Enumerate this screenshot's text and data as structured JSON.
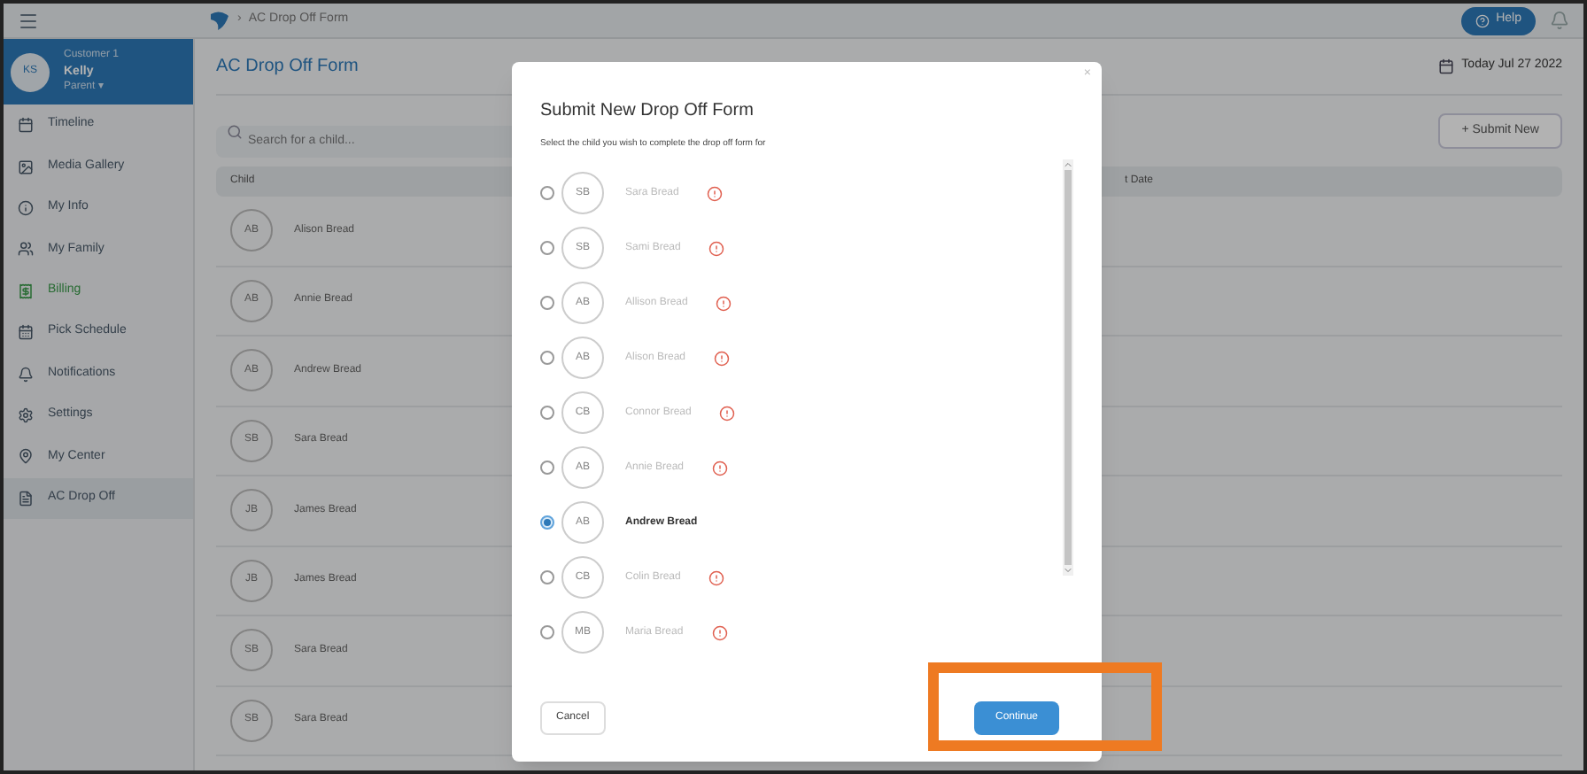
{
  "topbar": {
    "breadcrumb_separator": "›",
    "page": "AC Drop Off Form",
    "help": "Help"
  },
  "user": {
    "initials": "KS",
    "label": "Customer 1",
    "name": "Kelly",
    "role": "Parent ▾"
  },
  "sidebar": {
    "items": [
      {
        "label": "Timeline",
        "selected": false,
        "kind": "calendar"
      },
      {
        "label": "Media Gallery",
        "selected": false,
        "kind": "image"
      },
      {
        "label": "My Info",
        "selected": false,
        "kind": "info"
      },
      {
        "label": "My Family",
        "selected": false,
        "kind": "family"
      },
      {
        "label": "Billing",
        "selected": false,
        "kind": "billing"
      },
      {
        "label": "Pick Schedule",
        "selected": false,
        "kind": "schedule"
      },
      {
        "label": "Notifications",
        "selected": false,
        "kind": "bell"
      },
      {
        "label": "Settings",
        "selected": false,
        "kind": "gear"
      },
      {
        "label": "My Center",
        "selected": false,
        "kind": "pin"
      },
      {
        "label": "AC Drop Off",
        "selected": true,
        "kind": "drop"
      }
    ]
  },
  "page": {
    "title": "AC Drop Off Form",
    "date": "Today Jul 27 2022",
    "search": {
      "placeholder": "Search for a child..."
    },
    "submit_button": "+ Submit New"
  },
  "table": {
    "columns": [
      "Child",
      "t Date"
    ],
    "rows": [
      {
        "initials": "AB",
        "name": "Alison Bread"
      },
      {
        "initials": "AB",
        "name": "Annie Bread"
      },
      {
        "initials": "AB",
        "name": "Andrew Bread"
      },
      {
        "initials": "SB",
        "name": "Sara Bread"
      },
      {
        "initials": "JB",
        "name": "James Bread"
      },
      {
        "initials": "JB",
        "name": "James Bread"
      },
      {
        "initials": "SB",
        "name": "Sara Bread"
      },
      {
        "initials": "SB",
        "name": "Sara Bread"
      }
    ]
  },
  "modal": {
    "title": "Submit New Drop Off Form",
    "close": "×",
    "instruction": "Select the child you wish to complete the drop off form for",
    "children": [
      {
        "initials": "SB",
        "name": "Sara Bread",
        "selected": false,
        "disabled": true
      },
      {
        "initials": "SB",
        "name": "Sami Bread",
        "selected": false,
        "disabled": true
      },
      {
        "initials": "AB",
        "name": "Allison Bread",
        "selected": false,
        "disabled": true
      },
      {
        "initials": "AB",
        "name": "Alison Bread",
        "selected": false,
        "disabled": true
      },
      {
        "initials": "CB",
        "name": "Connor Bread",
        "selected": false,
        "disabled": true
      },
      {
        "initials": "AB",
        "name": "Annie Bread",
        "selected": false,
        "disabled": true
      },
      {
        "initials": "AB",
        "name": "Andrew Bread",
        "selected": true,
        "disabled": false
      },
      {
        "initials": "CB",
        "name": "Colin Bread",
        "selected": false,
        "disabled": true
      },
      {
        "initials": "MB",
        "name": "Maria Bread",
        "selected": false,
        "disabled": true
      }
    ],
    "cancel": "Cancel",
    "continue": "Continue"
  }
}
